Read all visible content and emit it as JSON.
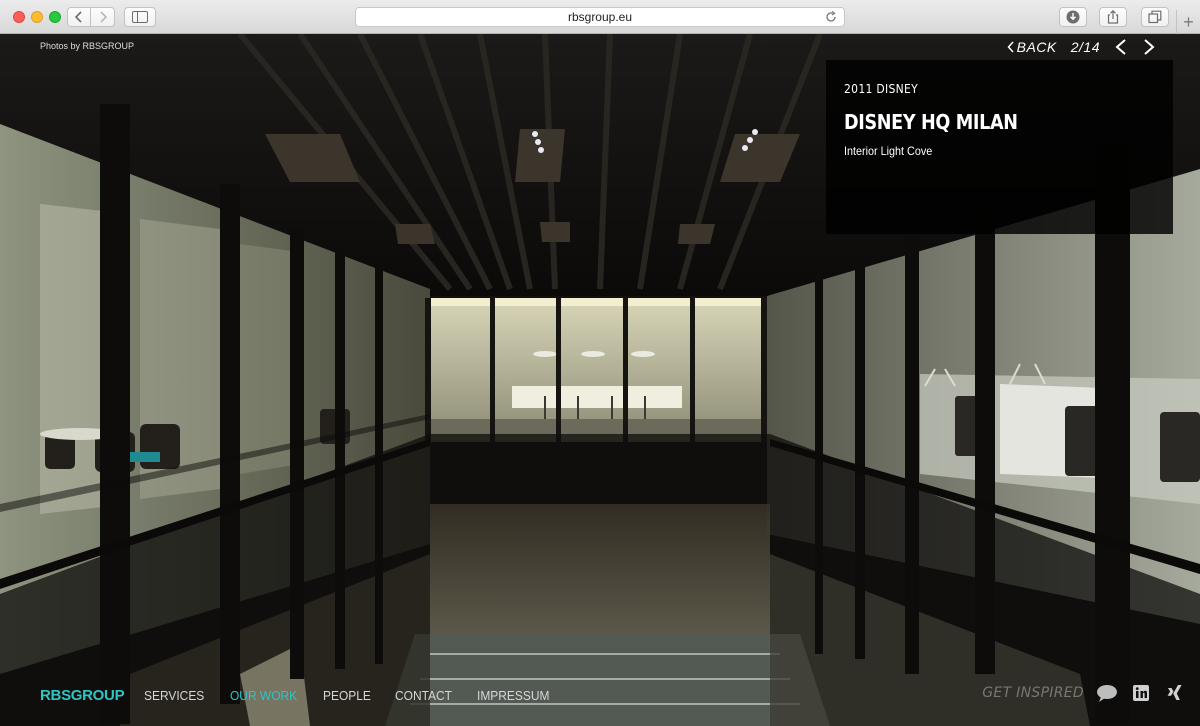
{
  "browser": {
    "url": "rbsgroup.eu",
    "plus_label": "+"
  },
  "page": {
    "photo_credit": "Photos by RBSGROUP"
  },
  "gallery": {
    "back_label": "BACK",
    "counter": "2/14"
  },
  "project": {
    "year_client": "2011 DISNEY",
    "title": "DISNEY HQ MILAN",
    "subtitle": "Interior Light Cove"
  },
  "nav": {
    "logo": "RBSGROUP",
    "items": [
      {
        "label": "SERVICES"
      },
      {
        "label": "OUR WORK"
      },
      {
        "label": "PEOPLE"
      },
      {
        "label": "CONTACT"
      },
      {
        "label": "IMPRESSUM"
      }
    ],
    "active_index": 1
  },
  "social": {
    "tagline": "GET INSPIRED",
    "icons": [
      "chat-icon",
      "linkedin-icon",
      "xing-icon"
    ]
  },
  "colors": {
    "accent": "#2ec5c5"
  }
}
